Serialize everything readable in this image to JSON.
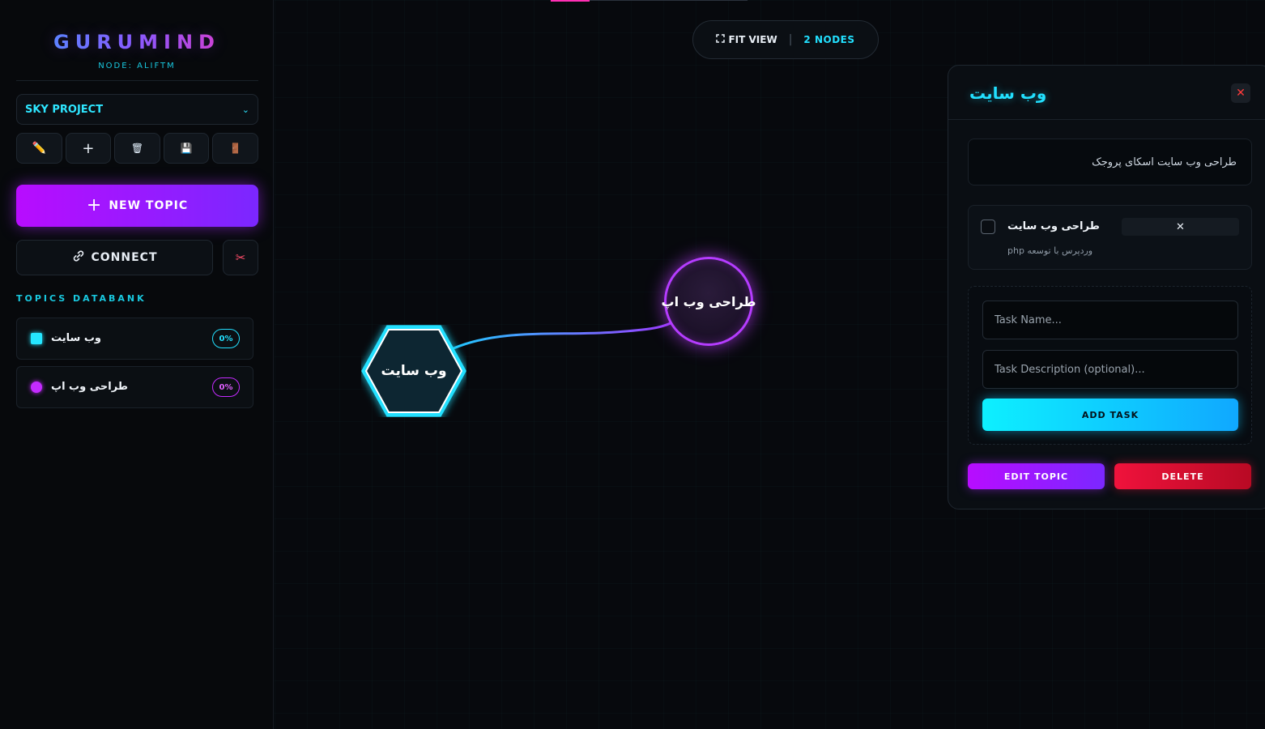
{
  "sidebar": {
    "brand": "GURUMIND",
    "node_id": "NODE: ALIFTM",
    "project": {
      "selected": "SKY PROJECT"
    },
    "tools": [
      {
        "name": "rename",
        "icon": "pencil-icon",
        "glyph": "✏️"
      },
      {
        "name": "add",
        "icon": "plus-icon",
        "glyph": "+"
      },
      {
        "name": "delete",
        "icon": "trash-icon",
        "glyph": "🗑"
      },
      {
        "name": "save",
        "icon": "floppy-disk-icon",
        "glyph": "💾"
      },
      {
        "name": "exit",
        "icon": "door-icon",
        "glyph": "🚪"
      }
    ],
    "new_topic_label": "NEW TOPIC",
    "connect_label": "CONNECT",
    "databank_title": "TOPICS DATABANK",
    "topics": [
      {
        "name": "وب سایت",
        "progress": "0%",
        "shape": "square",
        "color": "#25e6ff"
      },
      {
        "name": "طراحی وب اپ",
        "progress": "0%",
        "shape": "circle",
        "color": "#c42bff"
      }
    ]
  },
  "canvas": {
    "fit_view_label": "FIT VIEW",
    "node_count": "2 NODES",
    "nodes": [
      {
        "label": "وب سایت",
        "shape": "hexagon",
        "color": "#22e0ff"
      },
      {
        "label": "طراحی وب اپ",
        "shape": "circle",
        "color": "#b53cff"
      }
    ]
  },
  "panel": {
    "title": "وب سایت",
    "description": "طراحی وب سایت اسکای پروجک",
    "tasks": [
      {
        "name": "طراحی وب سایت",
        "description": "وردپرس با توسعه php",
        "done": false
      }
    ],
    "task_name_placeholder": "Task Name...",
    "task_desc_placeholder": "Task Description (optional)...",
    "add_task_label": "ADD TASK",
    "edit_label": "EDIT TOPIC",
    "delete_label": "DELETE"
  },
  "colors": {
    "accent_cyan": "#22e0ff",
    "accent_purple": "#b80cff",
    "danger": "#f0123c"
  }
}
